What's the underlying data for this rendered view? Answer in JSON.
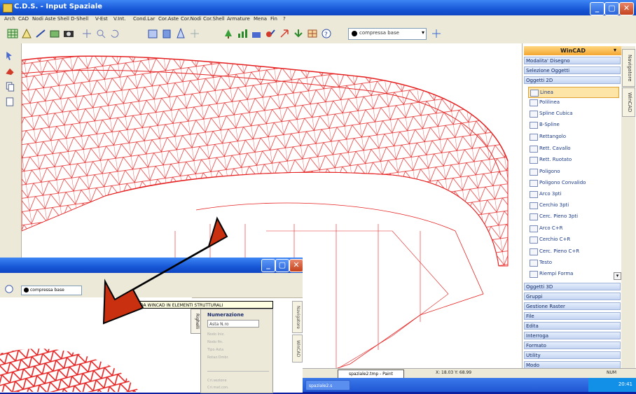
{
  "main": {
    "title": "C.D.S. - Input Spaziale",
    "menu": [
      "Arch",
      "CAD",
      "Nodi Aste Shell D-Shell",
      "V-Est",
      "V.Int.",
      "Cond.Lar",
      "Cor.Aste",
      "Cor.Nodi",
      "Cor.Shell",
      "Armature",
      "Mena",
      "Fin",
      "?"
    ],
    "layer": "compressa base",
    "caption": {
      "min": "_",
      "max": "▢",
      "close": "✕"
    }
  },
  "panel": {
    "header": "WinCAD",
    "sections_top": [
      "Modalita' Disegno",
      "Selezione Oggetti",
      "Oggetti 2D"
    ],
    "items": [
      "Linea",
      "Polilinea",
      "Spline Cubica",
      "B-Spline",
      "Rettangolo",
      "Rett. Cavallo",
      "Rett. Ruotato",
      "Poligono",
      "Poligono Convalido",
      "Arco 3pti",
      "Cerchio 3pti",
      "Cerc. Pieno 3pti",
      "Arco C+R",
      "Cerchio C+R",
      "Cerc. Pieno C+R",
      "Testo",
      "Riempi Forma"
    ],
    "sections_bottom": [
      "Oggetti 3D",
      "Gruppi",
      "Gestione Raster",
      "File",
      "Edita",
      "Interroga",
      "Formato",
      "Utility",
      "Modo"
    ],
    "vtabs": [
      "Navigatore",
      "WinCAD"
    ]
  },
  "status": {
    "popup": "spaziale2.tmp - Paint",
    "coords": "X: 18.03   Y: 68.99",
    "num": "NUM"
  },
  "taskbar": {
    "task": "spaziale2.s",
    "clock": "20:41"
  },
  "inset": {
    "select": "compressa base",
    "tooltip": "DA WINCAD IN ELEMENTI STRUTTURALI",
    "ruler_tab": "Righelli",
    "panel_title": "Numerazione",
    "field1": "Asta N.ro",
    "faded": [
      "Nodo Iniz.",
      "Nodo fin.",
      "Tipo Asta",
      "Rotaz.Ombr."
    ],
    "faded2": [
      "Cri.sezione",
      "Cri.mat.con."
    ],
    "vtabs": [
      "Navigatore",
      "WinCAD"
    ]
  },
  "colors": {
    "mesh": "#e62020",
    "arrow": "#c83010",
    "accent": "#f4a731",
    "titlebar": "#1757d6"
  }
}
